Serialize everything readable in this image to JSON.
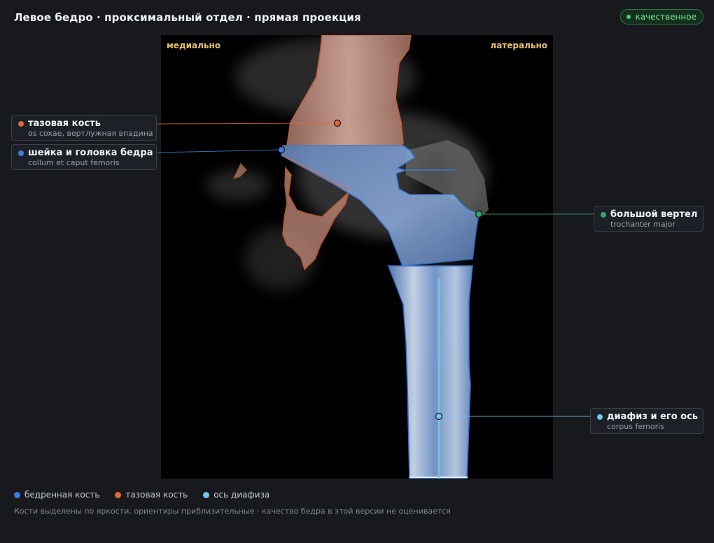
{
  "header": {
    "title": "Левое бедро · проксимальный отдел · прямая проекция",
    "quality_badge": "качественное",
    "quality_color": "#4bd26f"
  },
  "viewer": {
    "orientation_left": "медиально",
    "orientation_right": "латерально"
  },
  "colors": {
    "femur": "#3d7fe0",
    "pelvis": "#e06a3c",
    "shaft_axis": "#74c6f0",
    "trochanter": "#2fa86a"
  },
  "labels": [
    {
      "id": "pelvis",
      "name": "тазовая кость",
      "latin": "os coxae, вертлужная впадина",
      "color": "#e06a3c"
    },
    {
      "id": "neck",
      "name": "шейка и головка бедра",
      "latin": "collum et caput femoris",
      "color": "#3d7fe0"
    },
    {
      "id": "trochanter",
      "name": "большой вертел",
      "latin": "trochanter major",
      "color": "#2fa86a"
    },
    {
      "id": "shaft",
      "name": "диафиз и его ось",
      "latin": "corpus femoris",
      "color": "#74c6f0"
    }
  ],
  "legend": [
    {
      "label": "бедренная кость",
      "color": "#3d7fe0"
    },
    {
      "label": "тазовая кость",
      "color": "#e06a3c"
    },
    {
      "label": "ось диафиза",
      "color": "#74c6f0"
    }
  ],
  "footnote": "Кости выделены по яркости, ориентиры приблизительные · качество бедра в этой версии не оценивается"
}
